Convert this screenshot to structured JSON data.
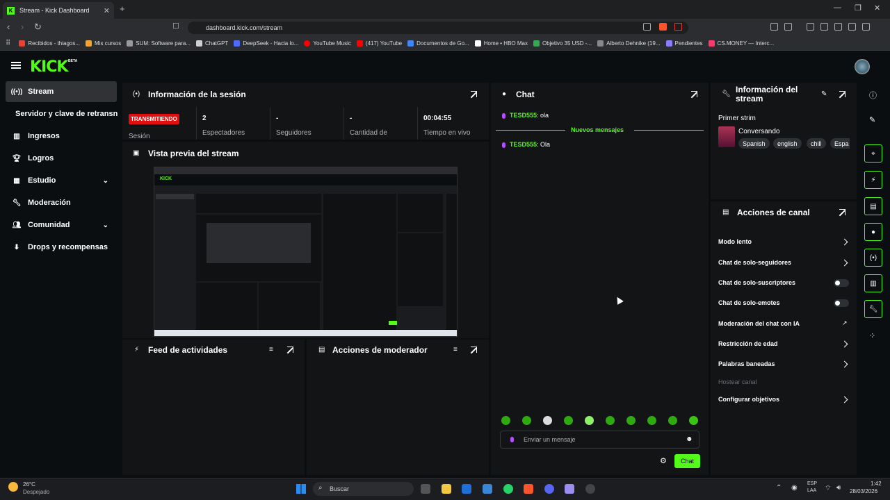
{
  "browser": {
    "tab_title": "Stream - Kick Dashboard",
    "tab_close": "✕",
    "new_tab": "+",
    "url": "dashboard.kick.com/stream",
    "bookmarks": [
      {
        "label": "Recibidos - thiagos...",
        "color": "#ea4335"
      },
      {
        "label": "Mis cursos",
        "color": "#f4a42c"
      },
      {
        "label": "SUM: Software para...",
        "color": "#999999"
      },
      {
        "label": "ChatGPT",
        "color": "#cfcfcf"
      },
      {
        "label": "DeepSeek - Hacia lo...",
        "color": "#4d6bfe"
      },
      {
        "label": "YouTube Music",
        "color": "#ff0000"
      },
      {
        "label": "(417) YouTube",
        "color": "#ff0000"
      },
      {
        "label": "Documentos de Go...",
        "color": "#4285f4"
      },
      {
        "label": "Home • HBO Max",
        "color": "#ffffff"
      },
      {
        "label": "Objetivo 35 USD -...",
        "color": "#34a853"
      },
      {
        "label": "Alberto Dehnike (19...",
        "color": "#888888"
      },
      {
        "label": "Pendientes",
        "color": "#8a7cff"
      },
      {
        "label": "CS.MONEY — Interc...",
        "color": "#ff3a6b"
      }
    ]
  },
  "header": {
    "logo": "KICK",
    "beta": "BETA"
  },
  "sidebar": {
    "items": [
      {
        "label": "Stream",
        "icon": "broadcast-icon"
      },
      {
        "label": "Servidor y clave de retransn"
      },
      {
        "label": "Ingresos",
        "icon": "chart-icon"
      },
      {
        "label": "Logros",
        "icon": "trophy-icon"
      },
      {
        "label": "Estudio",
        "icon": "studio-icon"
      },
      {
        "label": "Moderación",
        "icon": "wrench-icon"
      },
      {
        "label": "Comunidad",
        "icon": "community-icon"
      },
      {
        "label": "Drops y recompensas",
        "icon": "drops-icon"
      }
    ]
  },
  "session": {
    "title": "Información de la sesión",
    "status": "TRANSMITIENDO",
    "status_label": "Sesión",
    "stats": [
      {
        "value": "2",
        "label": "Espectadores"
      },
      {
        "value": "-",
        "label": "Seguidores"
      },
      {
        "value": "-",
        "label": "Cantidad de"
      },
      {
        "value": "00:04:55",
        "label": "Tiempo en vivo"
      }
    ]
  },
  "preview": {
    "title": "Vista previa del stream"
  },
  "activity": {
    "title": "Feed de actividades"
  },
  "modactions": {
    "title": "Acciones de moderador"
  },
  "chat": {
    "title": "Chat",
    "messages": [
      {
        "user": "TESD555",
        "text": ": ola"
      },
      {
        "user": "TESD555",
        "text": ": Ola"
      }
    ],
    "new_messages": "Nuevos mensajes",
    "input_placeholder": "Enviar un mensaje",
    "send": "Chat"
  },
  "stream_info": {
    "title_line1": "Información del",
    "title_line2": "stream",
    "stream_title": "Primer strim",
    "category": "Conversando",
    "tags": [
      "Spanish",
      "english",
      "chill",
      "Espa"
    ]
  },
  "channel_actions": {
    "title": "Acciones de canal",
    "items": [
      {
        "label": "Modo lento",
        "control": "chevron"
      },
      {
        "label": "Chat de solo-seguidores",
        "control": "chevron"
      },
      {
        "label": "Chat de solo-suscriptores",
        "control": "toggle"
      },
      {
        "label": "Chat de solo-emotes",
        "control": "toggle"
      },
      {
        "label": "Moderación del chat con IA",
        "control": "external"
      },
      {
        "label": "Restricción de edad",
        "control": "chevron"
      },
      {
        "label": "Palabras baneadas",
        "control": "chevron"
      },
      {
        "label": "Hostear canal",
        "control": "disabled"
      },
      {
        "label": "Configurar objetivos",
        "control": "chevron"
      }
    ]
  },
  "taskbar": {
    "weather_temp": "26°C",
    "weather_desc": "Despejado",
    "search": "Buscar",
    "lang1": "ESP",
    "lang2": "LAA",
    "time": "1:42",
    "date": "28/03/2026"
  },
  "colors": {
    "accent": "#53fc18",
    "live": "#e10f0f",
    "panel": "#121416"
  }
}
